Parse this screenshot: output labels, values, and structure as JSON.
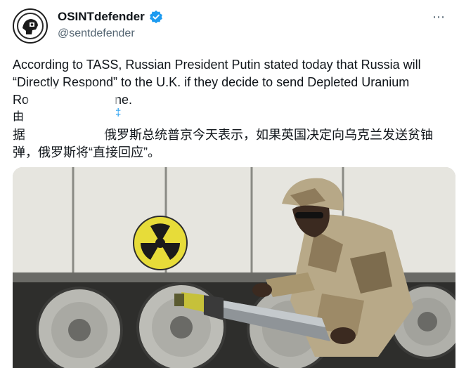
{
  "tweet": {
    "display_name": "OSINTdefender",
    "handle": "@sentdefender",
    "more_icon": "more-options-icon",
    "verified_icon": "verified-badge-icon",
    "text_en_lines": [
      "According to TASS, Russian President Putin stated today that Russia will",
      "“Directly Respond” to the U.K. if they decide to send Depleted Uranium",
      "Ro"
    ],
    "text_en_tail": "ne.",
    "partial_char": "由",
    "partial_translate_tail": "‡",
    "text_zh_lines": [
      "据",
      "弹，俄罗斯将“直接回应”。"
    ],
    "text_zh_line1_tail": "俄罗斯总统普京今天表示，如果英国决定向乌克兰发送贫铀",
    "watermark": "",
    "colors": {
      "accent": "#1d9bf0",
      "text": "#0f1419",
      "secondary": "#536471"
    }
  }
}
